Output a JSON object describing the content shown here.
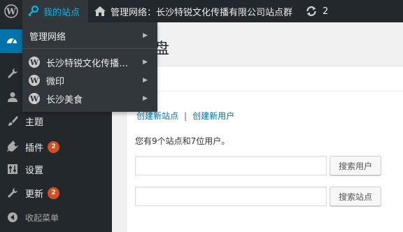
{
  "adminbar": {
    "my_sites_label": "我的站点",
    "network_label": "管理网络：长沙特锐文化传播有限公司站点群",
    "updates_count": "2"
  },
  "dropdown": {
    "items": [
      {
        "label": "管理网络",
        "icon": "none"
      },
      {
        "label": "长沙特锐文化传播有...",
        "icon": "wordpress-icon"
      },
      {
        "label": "微印",
        "icon": "wordpress-icon"
      },
      {
        "label": "长沙美食",
        "icon": "wordpress-icon"
      }
    ]
  },
  "sidebar": {
    "items": [
      {
        "label": "",
        "icon": "dashboard-icon"
      },
      {
        "label": "",
        "icon": "wrench-icon"
      },
      {
        "label": "",
        "icon": "user-icon"
      },
      {
        "label": "主题",
        "icon": "brush-icon"
      },
      {
        "label": "插件",
        "icon": "plugin-icon",
        "badge": "2"
      },
      {
        "label": "设置",
        "icon": "settings-icon"
      },
      {
        "label": "更新",
        "icon": "wrench-icon",
        "badge": "2"
      },
      {
        "label": "收起菜单",
        "icon": "collapse-icon"
      }
    ]
  },
  "main": {
    "title": "盘",
    "create_site_link": "创建新站点",
    "create_user_link": "创建新用户",
    "separator": "|",
    "stats_text": "您有9个站点和7位用户。",
    "search_users_button": "搜索用户",
    "search_sites_button": "搜索站点"
  },
  "colors": {
    "adminbar_bg": "#23282d",
    "accent": "#0073aa",
    "badge": "#d54e21",
    "link_hover": "#00b9eb"
  }
}
